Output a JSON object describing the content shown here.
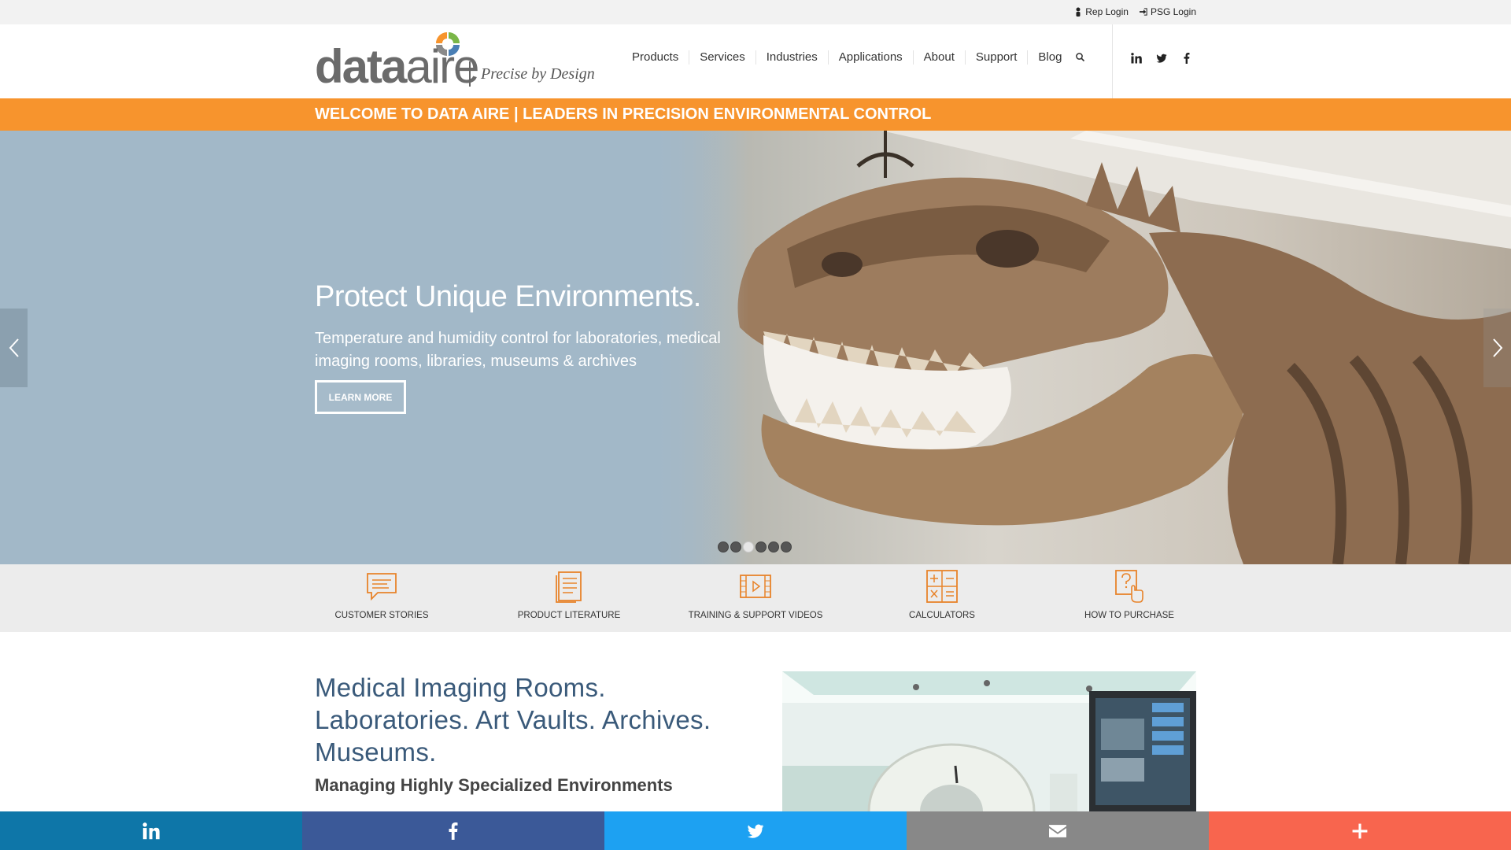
{
  "topbar": {
    "rep_login": "Rep Login",
    "psg_login": "PSG Login"
  },
  "logo": {
    "word_data": "data",
    "word_aire": "aire",
    "tagline": "Precise by Design"
  },
  "nav": {
    "items": [
      "Products",
      "Services",
      "Industries",
      "Applications",
      "About",
      "Support",
      "Blog"
    ]
  },
  "banner": {
    "text": "WELCOME TO DATA AIRE | LEADERS IN PRECISION ENVIRONMENTAL CONTROL"
  },
  "hero": {
    "title": "Protect Unique Environments.",
    "subtitle": "Temperature and humidity control for laboratories, medical imaging rooms, libraries, museums & archives",
    "button": "LEARN MORE",
    "slide_count": 6,
    "active_slide": 3
  },
  "quick_links": [
    {
      "label": "CUSTOMER STORIES",
      "icon": "chat-bubble-icon"
    },
    {
      "label": "PRODUCT LITERATURE",
      "icon": "document-icon"
    },
    {
      "label": "TRAINING & SUPPORT VIDEOS",
      "icon": "video-icon"
    },
    {
      "label": "CALCULATORS",
      "icon": "calculator-icon"
    },
    {
      "label": "HOW TO PURCHASE",
      "icon": "question-hand-icon"
    }
  ],
  "content": {
    "heading": "Medical Imaging Rooms. Laboratories. Art Vaults. Archives. Museums.",
    "subheading": "Managing Highly Specialized Environments"
  },
  "colors": {
    "accent_orange": "#f7942d",
    "hero_blue": "#a2b8c8",
    "heading_blue": "#3a5a7a",
    "share_linkedin": "#0e76a8",
    "share_facebook": "#3b5998",
    "share_twitter": "#1da1f2",
    "share_email": "#888888",
    "share_more": "#f8654e"
  }
}
